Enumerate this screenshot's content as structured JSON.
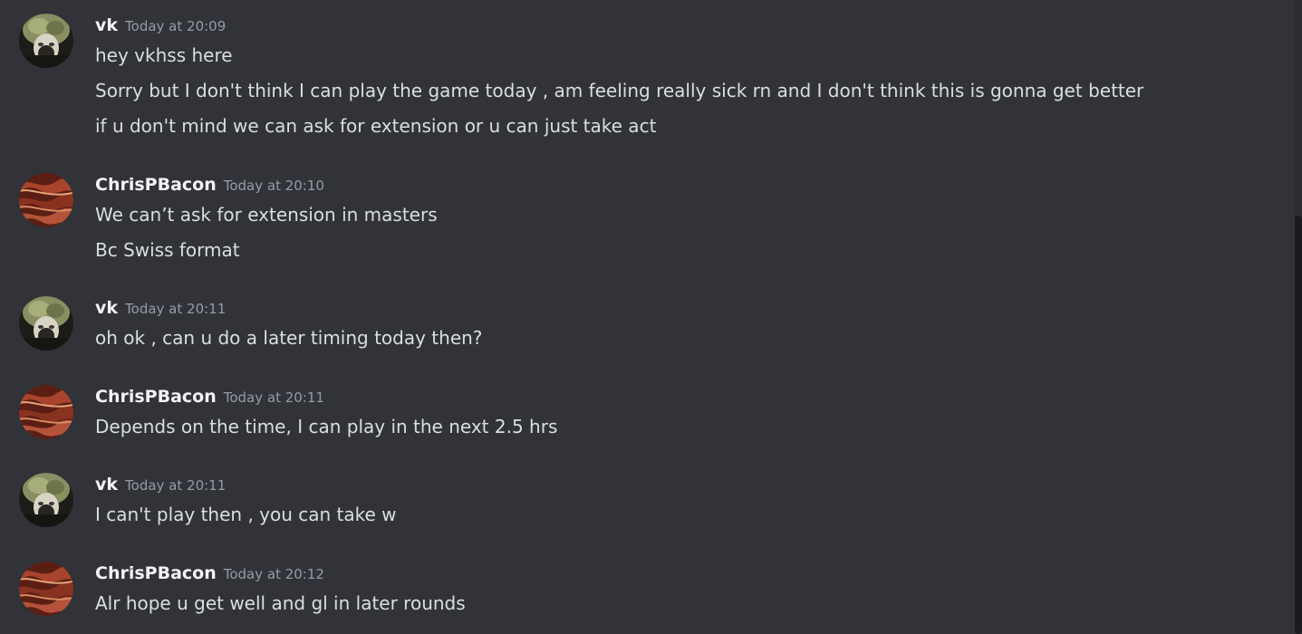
{
  "messages": [
    {
      "author": "vk",
      "timestamp": "Today at 20:09",
      "avatar": "vk-avatar-icon",
      "lines": [
        "hey vkhss here",
        "Sorry but I don't think I can play the game today , am feeling really sick rn and I don't think this is gonna get better",
        "if u don't mind we can ask for extension or u can just take act"
      ]
    },
    {
      "author": "ChrisPBacon",
      "timestamp": "Today at 20:10",
      "avatar": "bacon-avatar-icon",
      "lines": [
        "We can’t ask for extension in masters",
        "Bc Swiss format"
      ]
    },
    {
      "author": "vk",
      "timestamp": "Today at 20:11",
      "avatar": "vk-avatar-icon",
      "lines": [
        "oh ok , can u do a later timing today then?"
      ]
    },
    {
      "author": "ChrisPBacon",
      "timestamp": "Today at 20:11",
      "avatar": "bacon-avatar-icon",
      "lines": [
        "Depends on the time, I can play in the next 2.5 hrs"
      ]
    },
    {
      "author": "vk",
      "timestamp": "Today at 20:11",
      "avatar": "vk-avatar-icon",
      "lines": [
        "I can't play then , you can take w"
      ]
    },
    {
      "author": "ChrisPBacon",
      "timestamp": "Today at 20:12",
      "avatar": "bacon-avatar-icon",
      "lines": [
        "Alr hope u get well and gl in later rounds"
      ]
    }
  ],
  "colors": {
    "background": "#313338",
    "username": "#f2f3f5",
    "timestamp": "#949ba4",
    "message_text": "#dbdee1"
  }
}
